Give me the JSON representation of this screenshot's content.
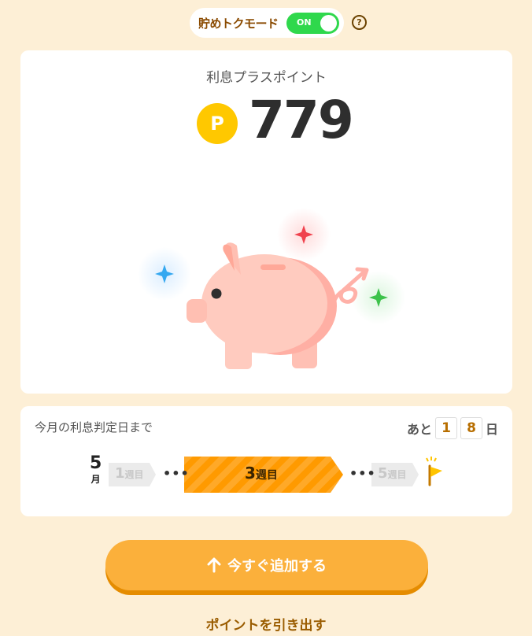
{
  "mode": {
    "label": "貯めトクモード",
    "toggle_state": "ON",
    "help_icon": "question-circle-icon"
  },
  "points": {
    "title": "利息プラスポイント",
    "coin_symbol": "P",
    "value": "779"
  },
  "countdown": {
    "label": "今月の利息判定日まで",
    "remaining_prefix": "あと",
    "digits": [
      "1",
      "8"
    ],
    "remaining_suffix": "日",
    "month_number": "5",
    "month_unit": "月",
    "weeks": [
      {
        "num": "1",
        "unit": "週目"
      },
      {
        "num": "3",
        "unit": "週目"
      },
      {
        "num": "5",
        "unit": "週目"
      }
    ],
    "ellipsis": "•••"
  },
  "actions": {
    "add_label": "今すぐ追加する",
    "add_icon": "arrow-up-icon",
    "withdraw_label": "ポイントを引き出す"
  },
  "colors": {
    "background": "#FDEFD6",
    "accent": "#FBB03B",
    "toggle_on": "#2FD84C",
    "coin": "#FFC800",
    "pig": "#FFCBBF"
  }
}
